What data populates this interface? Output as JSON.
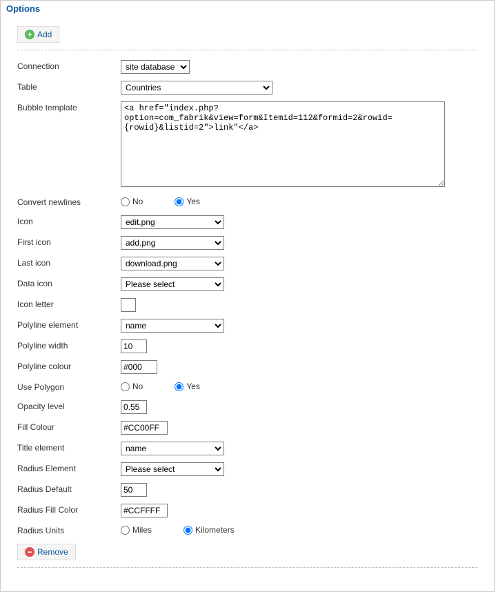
{
  "panelTitle": "Options",
  "addLabel": "Add",
  "removeLabel": "Remove",
  "fields": {
    "connection": {
      "label": "Connection",
      "value": "site database"
    },
    "table": {
      "label": "Table",
      "value": "Countries"
    },
    "bubble": {
      "label": "Bubble template",
      "value": "<a href=\"index.php?option=com_fabrik&view=form&Itemid=112&formid=2&rowid={rowid}&listid=2\">link\"</a>"
    },
    "convert": {
      "label": "Convert newlines",
      "no": "No",
      "yes": "Yes",
      "value": "yes"
    },
    "icon": {
      "label": "Icon",
      "value": "edit.png"
    },
    "firstIcon": {
      "label": "First icon",
      "value": "add.png"
    },
    "lastIcon": {
      "label": "Last icon",
      "value": "download.png"
    },
    "dataIcon": {
      "label": "Data icon",
      "value": "Please select"
    },
    "iconLetter": {
      "label": "Icon letter",
      "value": ""
    },
    "polyElem": {
      "label": "Polyline element",
      "value": "name"
    },
    "polyWidth": {
      "label": "Polyline width",
      "value": "10"
    },
    "polyColour": {
      "label": "Polyline colour",
      "value": "#000"
    },
    "usePolygon": {
      "label": "Use Polygon",
      "no": "No",
      "yes": "Yes",
      "value": "yes"
    },
    "opacity": {
      "label": "Opacity level",
      "value": "0.55"
    },
    "fillColour": {
      "label": "Fill Colour",
      "value": "#CC00FF"
    },
    "titleElem": {
      "label": "Title element",
      "value": "name"
    },
    "radiusElem": {
      "label": "Radius Element",
      "value": "Please select"
    },
    "radiusDef": {
      "label": "Radius Default",
      "value": "50"
    },
    "radiusFill": {
      "label": "Radius Fill Color",
      "value": "#CCFFFF"
    },
    "radiusUnits": {
      "label": "Radius Units",
      "miles": "Miles",
      "km": "Kilometers",
      "value": "km"
    }
  }
}
